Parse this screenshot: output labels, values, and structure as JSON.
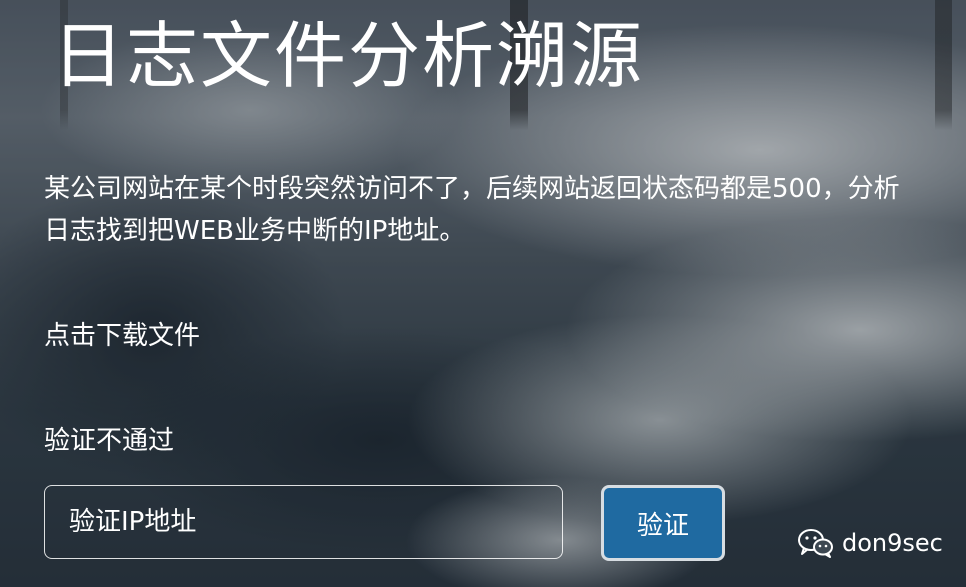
{
  "page": {
    "title": "日志文件分析溯源",
    "description": "某公司网站在某个时段突然访问不了，后续网站返回状态码都是500，分析日志找到把WEB业务中断的IP地址。",
    "download_link": "点击下载文件",
    "status_text": "验证不通过"
  },
  "form": {
    "ip_input_placeholder": "验证IP地址",
    "ip_input_value": "",
    "verify_button_label": "验证"
  },
  "watermark": {
    "icon": "wechat-icon",
    "text": "don9sec"
  },
  "colors": {
    "button_background": "#1f6aa1",
    "button_border": "#d7dde2",
    "text": "#ffffff"
  }
}
